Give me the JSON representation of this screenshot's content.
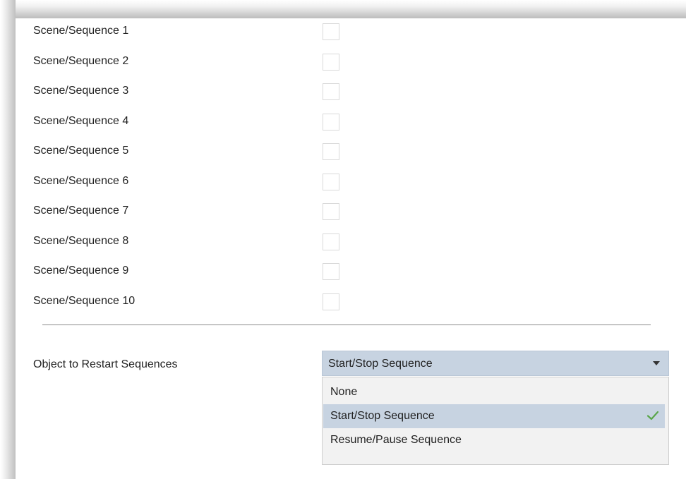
{
  "scenes": [
    {
      "label": "Scene/Sequence 1",
      "checked": false
    },
    {
      "label": "Scene/Sequence 2",
      "checked": false
    },
    {
      "label": "Scene/Sequence 3",
      "checked": false
    },
    {
      "label": "Scene/Sequence 4",
      "checked": false
    },
    {
      "label": "Scene/Sequence 5",
      "checked": false
    },
    {
      "label": "Scene/Sequence 6",
      "checked": false
    },
    {
      "label": "Scene/Sequence 7",
      "checked": false
    },
    {
      "label": "Scene/Sequence 8",
      "checked": false
    },
    {
      "label": "Scene/Sequence 9",
      "checked": false
    },
    {
      "label": "Scene/Sequence 10",
      "checked": false
    }
  ],
  "restart": {
    "label": "Object to Restart Sequences",
    "selected": "Start/Stop Sequence",
    "options": [
      "None",
      "Start/Stop Sequence",
      "Resume/Pause Sequence"
    ],
    "selected_index": 1
  },
  "icons": {
    "dropdown_arrow": "chevron-down-icon",
    "selected_check": "check-icon"
  },
  "colors": {
    "selection_bg": "#c7d3e1",
    "check_green": "#5aa64a"
  }
}
